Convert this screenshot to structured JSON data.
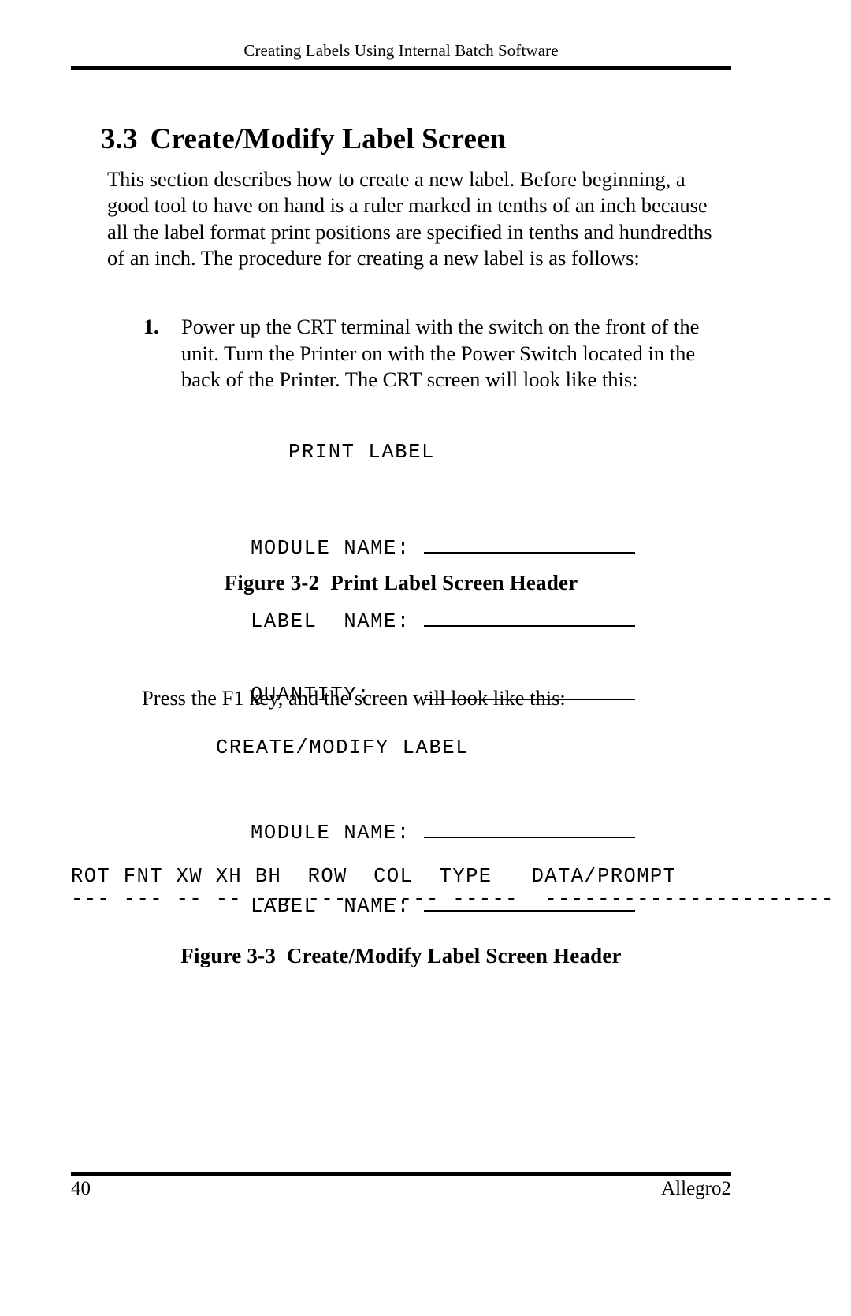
{
  "header": {
    "running_title": "Creating Labels Using Internal Batch Software"
  },
  "section": {
    "number": "3.3",
    "title": "Create/Modify Label Screen"
  },
  "intro": {
    "paragraph": "This section describes how to create a new label. Before beginning, a good tool to have on hand is a ruler marked in tenths of an inch because all the label format print positions are specified in tenths and hundredths of an inch. The procedure for creating a new label is as follows:"
  },
  "steps": [
    {
      "number": "1.",
      "text": "Power up the CRT terminal with the switch on the front of the unit. Turn the Printer on with the Power Switch located in the back of the Printer. The CRT screen will look like this:"
    }
  ],
  "figures": [
    {
      "id": "figure-3-2",
      "screen_title": "PRINT LABEL",
      "fields": [
        {
          "label": "MODULE NAME:",
          "value": ""
        },
        {
          "label": "LABEL  NAME:",
          "value": ""
        },
        {
          "label": "QUANTITY:",
          "value": ""
        }
      ],
      "caption": "Figure 3-2  Print Label Screen Header"
    },
    {
      "id": "figure-3-3",
      "screen_title": "CREATE/MODIFY LABEL",
      "fields": [
        {
          "label": "MODULE NAME:",
          "value": ""
        },
        {
          "label": "LABEL  NAME:",
          "value": ""
        }
      ],
      "columns_line": "ROT FNT XW XH BH  ROW  COL  TYPE   DATA/PROMPT",
      "columns_rule": "--- --- -- -- --- ---- ----- -----  ----------------------",
      "columns": [
        "ROT",
        "FNT",
        "XW",
        "XH",
        "BH",
        "ROW",
        "COL",
        "TYPE",
        "DATA/PROMPT"
      ],
      "caption": "Figure 3-3  Create/Modify Label Screen Header"
    }
  ],
  "body": {
    "press_f1": "Press the F1 key, and the screen will look like this:"
  },
  "footer": {
    "page_number": "40",
    "product": "Allegro2"
  }
}
